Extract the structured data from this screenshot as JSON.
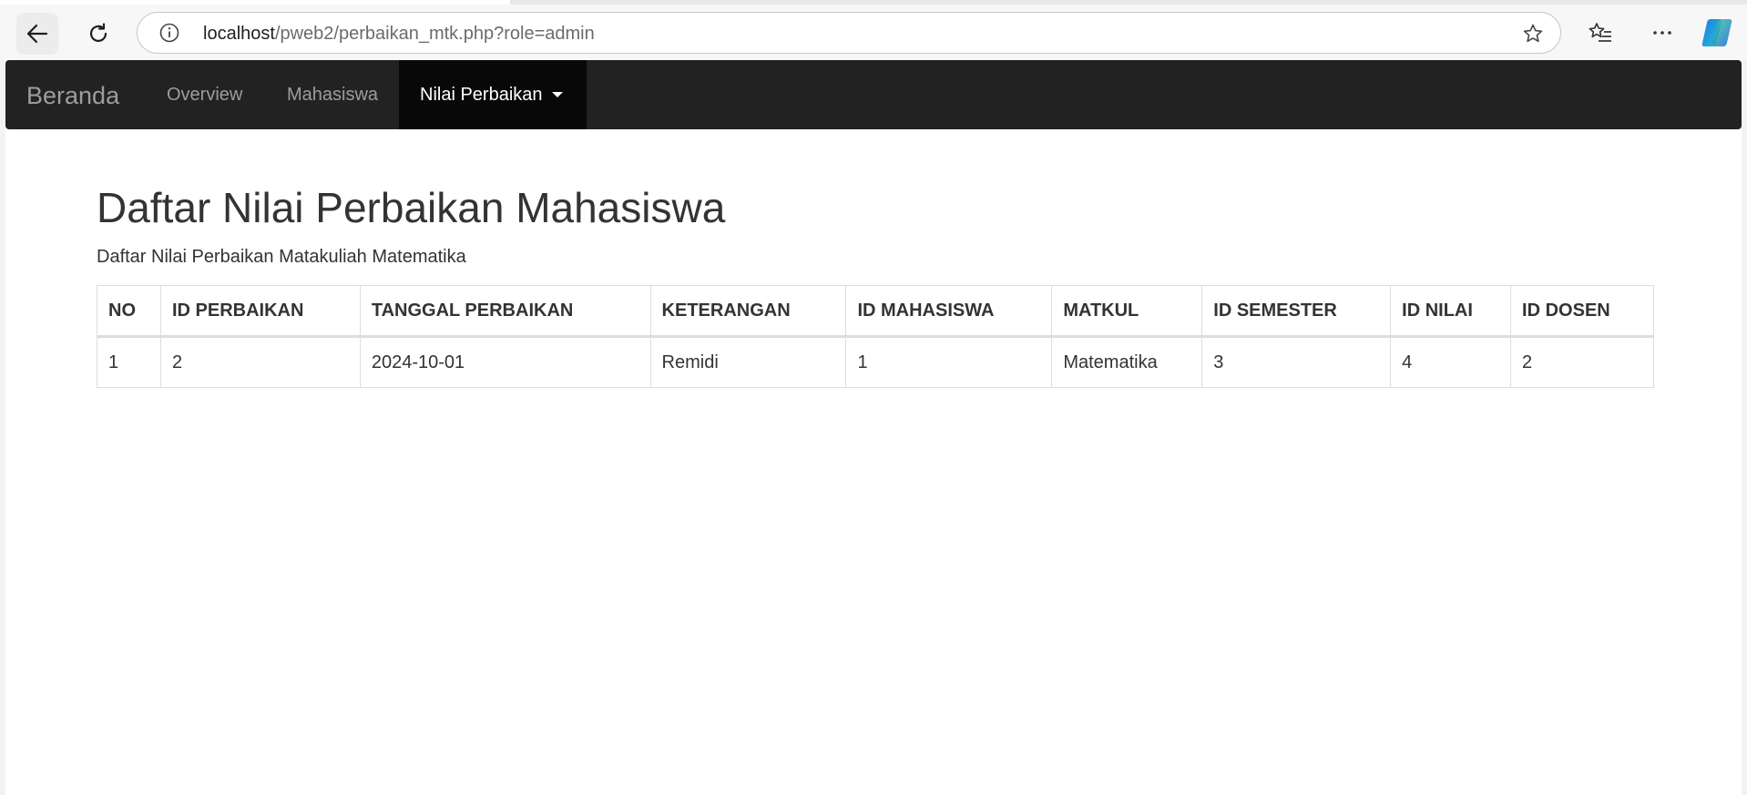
{
  "browser": {
    "url_host": "localhost",
    "url_path": "/pweb2/perbaikan_mtk.php?role=admin"
  },
  "navbar": {
    "brand": "Beranda",
    "items": [
      {
        "label": "Overview"
      },
      {
        "label": "Mahasiswa"
      },
      {
        "label": "Nilai Perbaikan",
        "active": true
      }
    ]
  },
  "main": {
    "title": "Daftar Nilai Perbaikan Mahasiswa",
    "subtitle": "Daftar Nilai Perbaikan Matakuliah Matematika"
  },
  "table": {
    "headers": [
      "NO",
      "ID PERBAIKAN",
      "TANGGAL PERBAIKAN",
      "KETERANGAN",
      "ID MAHASISWA",
      "MATKUL",
      "ID SEMESTER",
      "ID NILAI",
      "ID DOSEN"
    ],
    "rows": [
      [
        "1",
        "2",
        "2024-10-01",
        "Remidi",
        "1",
        "Matematika",
        "3",
        "4",
        "2"
      ]
    ]
  },
  "icons": {
    "back": "arrow-left-icon",
    "reload": "reload-icon",
    "info": "info-icon",
    "star": "star-icon",
    "favorites": "favorites-icon",
    "more": "more-icon",
    "copilot": "copilot-icon"
  },
  "colors": {
    "navbar_bg": "#222222",
    "navbar_active_bg": "#080808",
    "text": "#333333"
  }
}
